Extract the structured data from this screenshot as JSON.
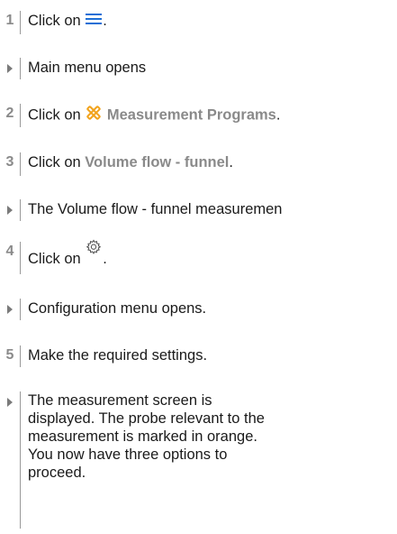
{
  "steps": [
    {
      "marker": "1",
      "pre": "Click on",
      "post": "."
    },
    {
      "marker": "result",
      "text": "Main menu opens"
    },
    {
      "marker": "2",
      "pre": "Click on",
      "link": "Measurement Programs",
      "post": "."
    },
    {
      "marker": "3",
      "pre": "Click on",
      "link": "Volume flow - funnel",
      "post": "."
    },
    {
      "marker": "result",
      "text": "The Volume flow - funnel measuremen"
    },
    {
      "marker": "4",
      "pre": "Click on",
      "post": "."
    },
    {
      "marker": "result",
      "text": "Configuration menu opens."
    },
    {
      "marker": "5",
      "text": "Make the required settings."
    },
    {
      "marker": "result",
      "text": "The measurement screen is displayed. The probe relevant to the measurement is marked in orange. You now have three options to proceed."
    }
  ],
  "icons": {
    "step1": "menu-hamburger-icon",
    "step2": "measurement-tools-icon",
    "step4": "settings-gear-icon"
  },
  "colors": {
    "accent_blue": "#1d6fd6",
    "accent_orange": "#f2a31b",
    "step_number": "#8a8a8a",
    "text": "#1a1a1a"
  }
}
